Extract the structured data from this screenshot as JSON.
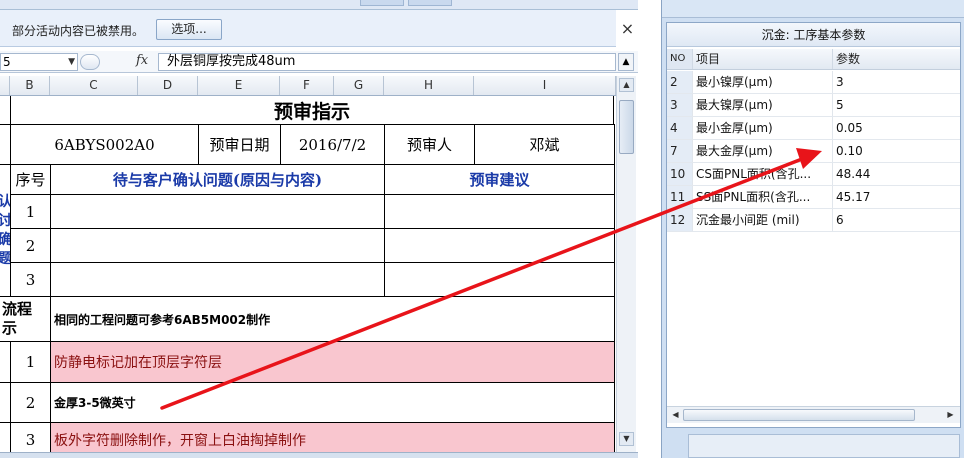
{
  "excel": {
    "message_bar": {
      "text": "部分活动内容已被禁用。",
      "options_label": "选项...",
      "close_glyph": "×"
    },
    "formula_bar": {
      "name_box": "5",
      "fx": "fx",
      "content": "外层铜厚按完成48um"
    },
    "columns": [
      "B",
      "C",
      "D",
      "E",
      "F",
      "G",
      "H",
      "I"
    ],
    "sheet": {
      "title": "预审指示",
      "info_row": {
        "code": "6ABYS002A0",
        "date_label": "预审日期",
        "date_value": "2016/7/2",
        "reviewer_label": "预审人",
        "reviewer_value": "邓斌"
      },
      "confirm_section": {
        "side_label": "认\n讨\n确\n题",
        "header_no": "序号",
        "header_issue": "待与客户确认问题(原因与内容)",
        "header_suggest": "预审建议",
        "rows": [
          "1",
          "2",
          "3"
        ]
      },
      "process_section": {
        "side_label": "流程\n示",
        "note": "相同的工程问题可参考6AB5M002制作",
        "rows": [
          {
            "no": "1",
            "text": "防静电标记加在顶层字符层",
            "highlight": true
          },
          {
            "no": "2",
            "text": "金厚3-5微英寸",
            "highlight": false
          },
          {
            "no": "3",
            "text": "板外字符删除制作，开窗上白油掏掉制作",
            "highlight": true
          }
        ]
      }
    }
  },
  "panel": {
    "title": "沉金: 工序基本参数",
    "headers": {
      "no": "NO",
      "item": "项目",
      "value": "参数"
    },
    "rows": [
      {
        "no": "2",
        "item": "最小镍厚(μm)",
        "value": "3"
      },
      {
        "no": "3",
        "item": "最大镍厚(μm)",
        "value": "5"
      },
      {
        "no": "4",
        "item": "最小金厚(μm)",
        "value": "0.05"
      },
      {
        "no": "7",
        "item": "最大金厚(μm)",
        "value": "0.10"
      },
      {
        "no": "10",
        "item": "CS面PNL面积(含孔...",
        "value": "48.44"
      },
      {
        "no": "11",
        "item": "SS面PNL面积(含孔...",
        "value": "45.17"
      },
      {
        "no": "12",
        "item": "沉金最小间距 (mil)",
        "value": "6"
      }
    ]
  },
  "annotation": {
    "arrow_color": "#e8141a"
  }
}
